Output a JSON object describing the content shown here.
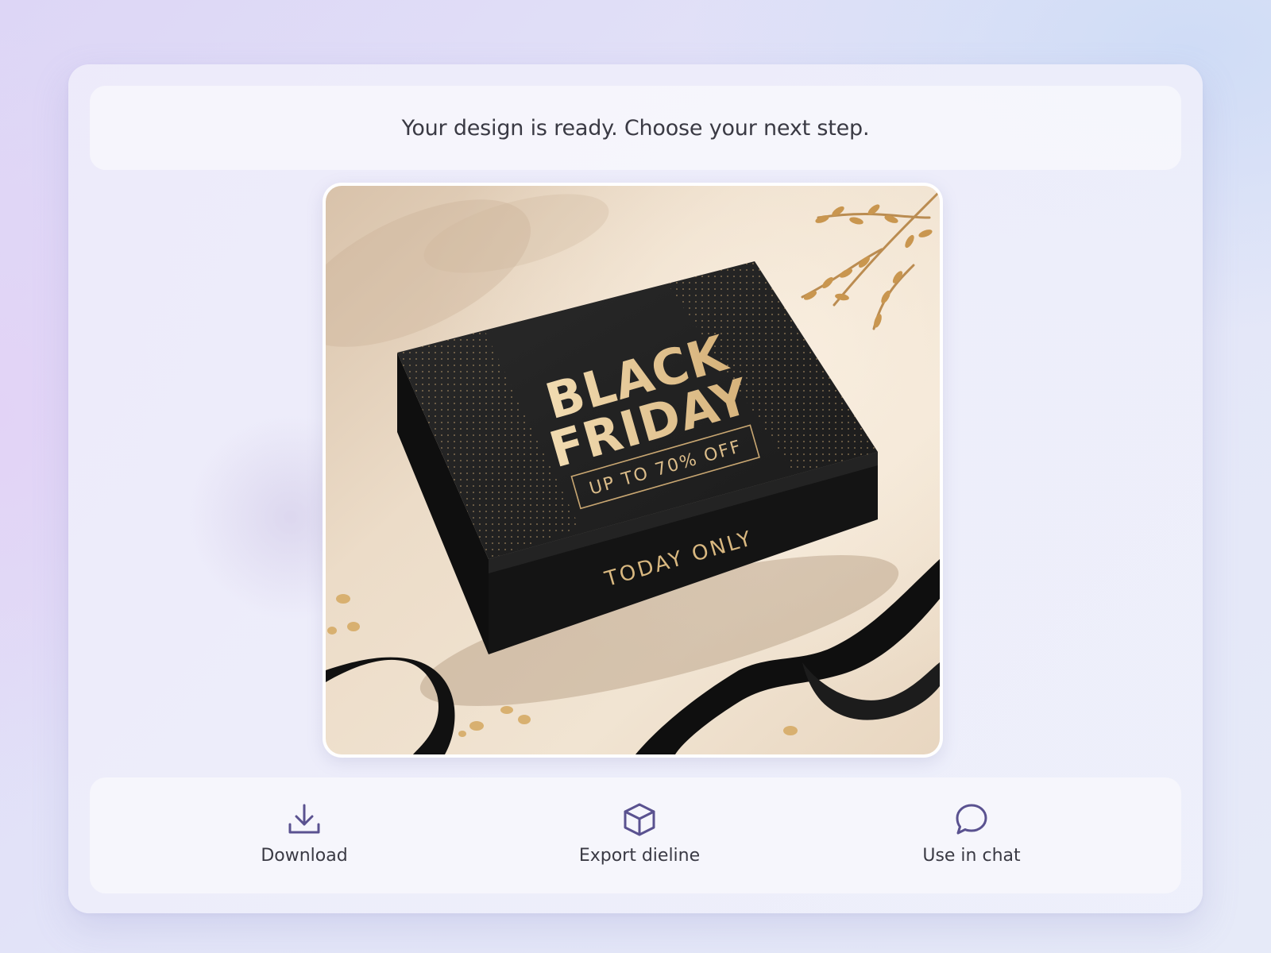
{
  "header": {
    "message": "Your design is ready. Choose your next step."
  },
  "preview": {
    "box_title_line1": "BLACK",
    "box_title_line2": "FRIDAY",
    "box_offer": "UP TO 70% OFF",
    "box_side_text": "TODAY ONLY"
  },
  "actions": [
    {
      "label": "Download",
      "icon": "download-icon"
    },
    {
      "label": "Export dieline",
      "icon": "box-icon"
    },
    {
      "label": "Use in chat",
      "icon": "chat-bubble-icon"
    }
  ],
  "colors": {
    "icon_accent": "#5a5290",
    "text": "#3a3a44",
    "gold": "#d9b880",
    "box": "#1e1e1e"
  }
}
